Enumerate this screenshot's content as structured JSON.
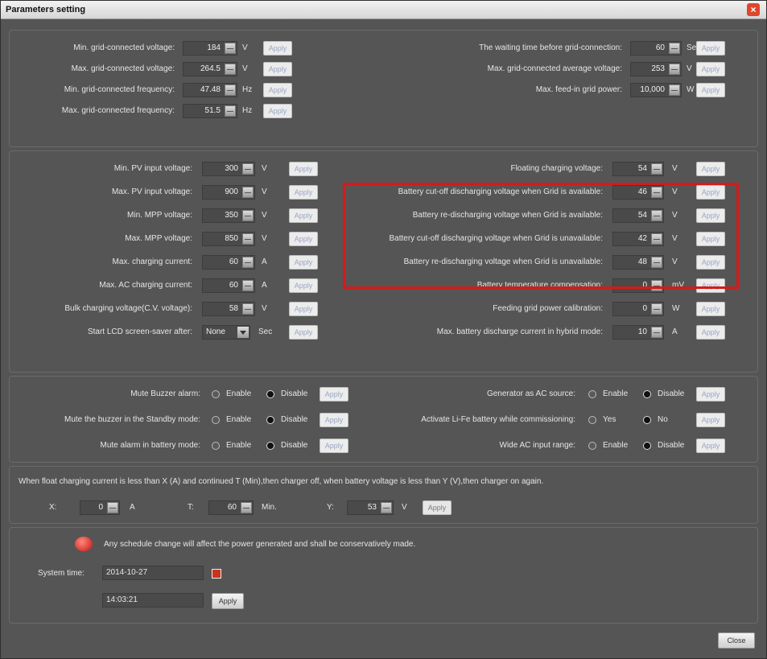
{
  "window": {
    "title": "Parameters setting",
    "close_label": "Close"
  },
  "apply_label": "Apply",
  "grid": {
    "left": [
      {
        "label": "Min. grid-connected voltage:",
        "value": "184",
        "unit": "V"
      },
      {
        "label": "Max. grid-connected voltage:",
        "value": "264.5",
        "unit": "V"
      },
      {
        "label": "Min. grid-connected frequency:",
        "value": "47.48",
        "unit": "Hz"
      },
      {
        "label": "Max. grid-connected frequency:",
        "value": "51.5",
        "unit": "Hz"
      }
    ],
    "right": [
      {
        "label": "The waiting time before grid-connection:",
        "value": "60",
        "unit": "Sec"
      },
      {
        "label": "Max. grid-connected average voltage:",
        "value": "253",
        "unit": "V"
      },
      {
        "label": "Max. feed-in grid power:",
        "value": "10,000",
        "unit": "W"
      }
    ]
  },
  "pv": {
    "left": [
      {
        "label": "Min. PV input voltage:",
        "value": "300",
        "unit": "V"
      },
      {
        "label": "Max. PV input voltage:",
        "value": "900",
        "unit": "V"
      },
      {
        "label": "Min. MPP voltage:",
        "value": "350",
        "unit": "V"
      },
      {
        "label": "Max. MPP voltage:",
        "value": "850",
        "unit": "V"
      },
      {
        "label": "Max. charging current:",
        "value": "60",
        "unit": "A"
      },
      {
        "label": "Max. AC charging current:",
        "value": "60",
        "unit": "A"
      },
      {
        "label": "Bulk charging voltage(C.V. voltage):",
        "value": "58",
        "unit": "V"
      }
    ],
    "screensaver": {
      "label": "Start LCD screen-saver after:",
      "value": "None",
      "unit": "Sec"
    },
    "right": [
      {
        "label": "Floating charging voltage:",
        "value": "54",
        "unit": "V"
      },
      {
        "label": "Battery cut-off discharging voltage when Grid is available:",
        "value": "46",
        "unit": "V"
      },
      {
        "label": "Battery re-discharging voltage when Grid is available:",
        "value": "54",
        "unit": "V"
      },
      {
        "label": "Battery cut-off discharging voltage when Grid is unavailable:",
        "value": "42",
        "unit": "V"
      },
      {
        "label": "Battery re-discharging voltage when Grid is unavailable:",
        "value": "48",
        "unit": "V"
      },
      {
        "label": "Battery temperature compensation:",
        "value": "0",
        "unit": "mV"
      },
      {
        "label": "Feeding grid power calibration:",
        "value": "0",
        "unit": "W"
      },
      {
        "label": "Max. battery discharge current in hybrid mode:",
        "value": "10",
        "unit": "A"
      }
    ]
  },
  "toggles": {
    "left": [
      {
        "label": "Mute Buzzer alarm:",
        "opt1": "Enable",
        "opt2": "Disable",
        "selected": 2
      },
      {
        "label": "Mute the buzzer in the Standby mode:",
        "opt1": "Enable",
        "opt2": "Disable",
        "selected": 2
      },
      {
        "label": "Mute alarm in battery mode:",
        "opt1": "Enable",
        "opt2": "Disable",
        "selected": 2
      }
    ],
    "right": [
      {
        "label": "Generator as AC source:",
        "opt1": "Enable",
        "opt2": "Disable",
        "selected": 2
      },
      {
        "label": "Activate Li-Fe battery while commissioning:",
        "opt1": "Yes",
        "opt2": "No",
        "selected": 2
      },
      {
        "label": "Wide AC input range:",
        "opt1": "Enable",
        "opt2": "Disable",
        "selected": 2
      }
    ]
  },
  "float": {
    "text": "When float charging current is less than X (A) and continued T (Min),then charger off, when battery voltage is less than Y (V),then charger on again.",
    "x": {
      "label": "X:",
      "value": "0",
      "unit": "A"
    },
    "t": {
      "label": "T:",
      "value": "60",
      "unit": "Min."
    },
    "y": {
      "label": "Y:",
      "value": "53",
      "unit": "V"
    }
  },
  "schedule": {
    "note": "Any schedule change will affect the power generated and shall be conservatively made.",
    "system_time_label": "System time:",
    "date": "2014-10-27",
    "time": "14:03:21"
  }
}
